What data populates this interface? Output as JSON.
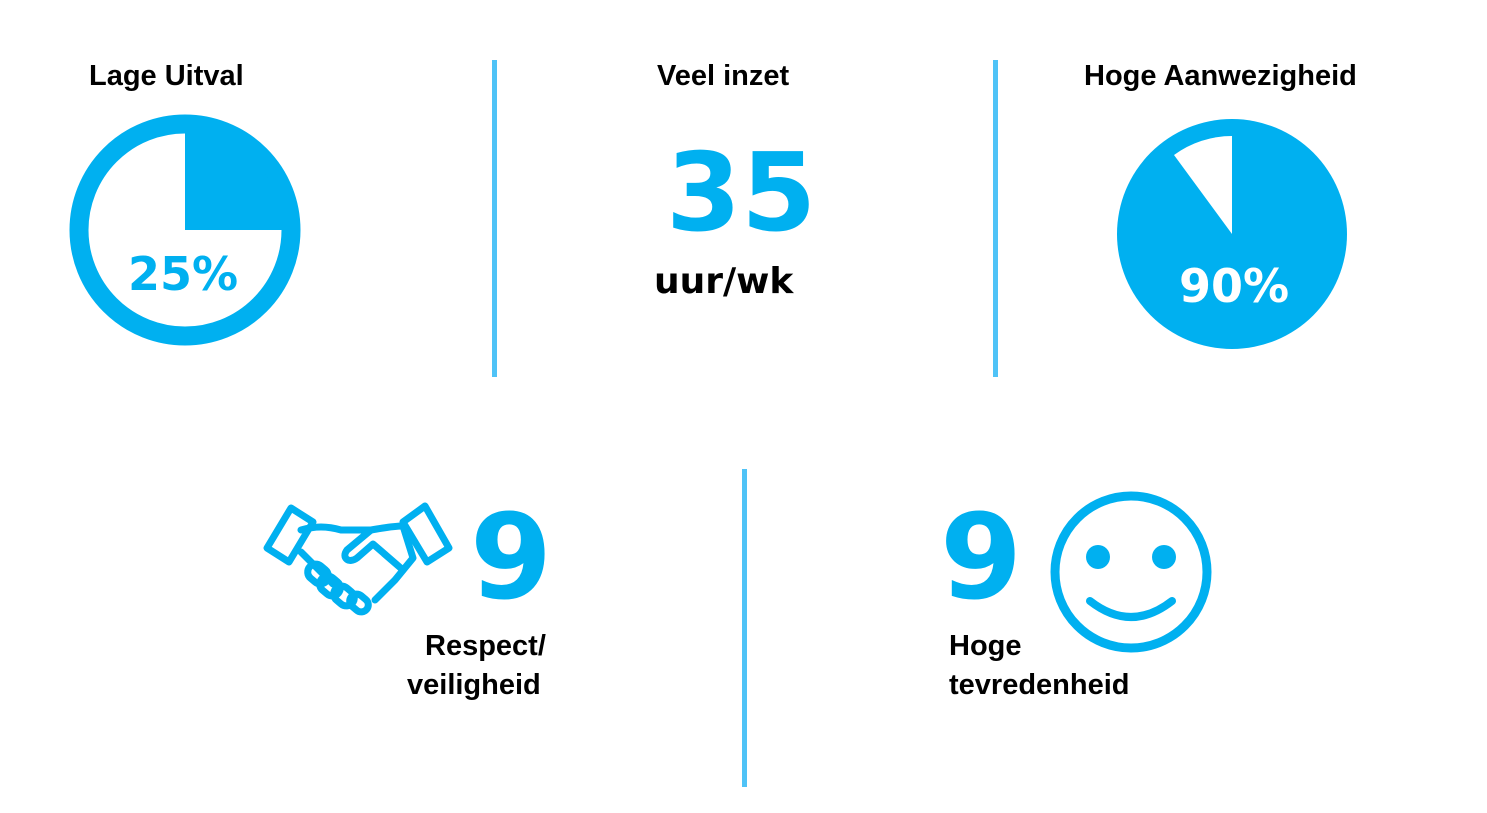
{
  "colors": {
    "accent": "#00b0f0",
    "divider": "#4fc3f7",
    "text": "#000000",
    "background": "#ffffff"
  },
  "stats": {
    "low_dropout": {
      "title": "Lage Uitval",
      "value_label": "25%",
      "fraction": 0.25,
      "icon": "pie-outline-icon"
    },
    "effort": {
      "title": "Veel inzet",
      "value": "35",
      "unit": "uur/wk"
    },
    "attendance": {
      "title": "Hoge Aanwezigheid",
      "value_label": "90%",
      "fraction": 0.9,
      "icon": "pie-filled-icon"
    },
    "respect": {
      "value": "9",
      "label_line1": "Respect/",
      "label_line2": "veiligheid",
      "icon": "handshake-icon"
    },
    "satisfaction": {
      "value": "9",
      "label_line1": "Hoge",
      "label_line2": "tevredenheid",
      "icon": "smiley-icon"
    }
  }
}
